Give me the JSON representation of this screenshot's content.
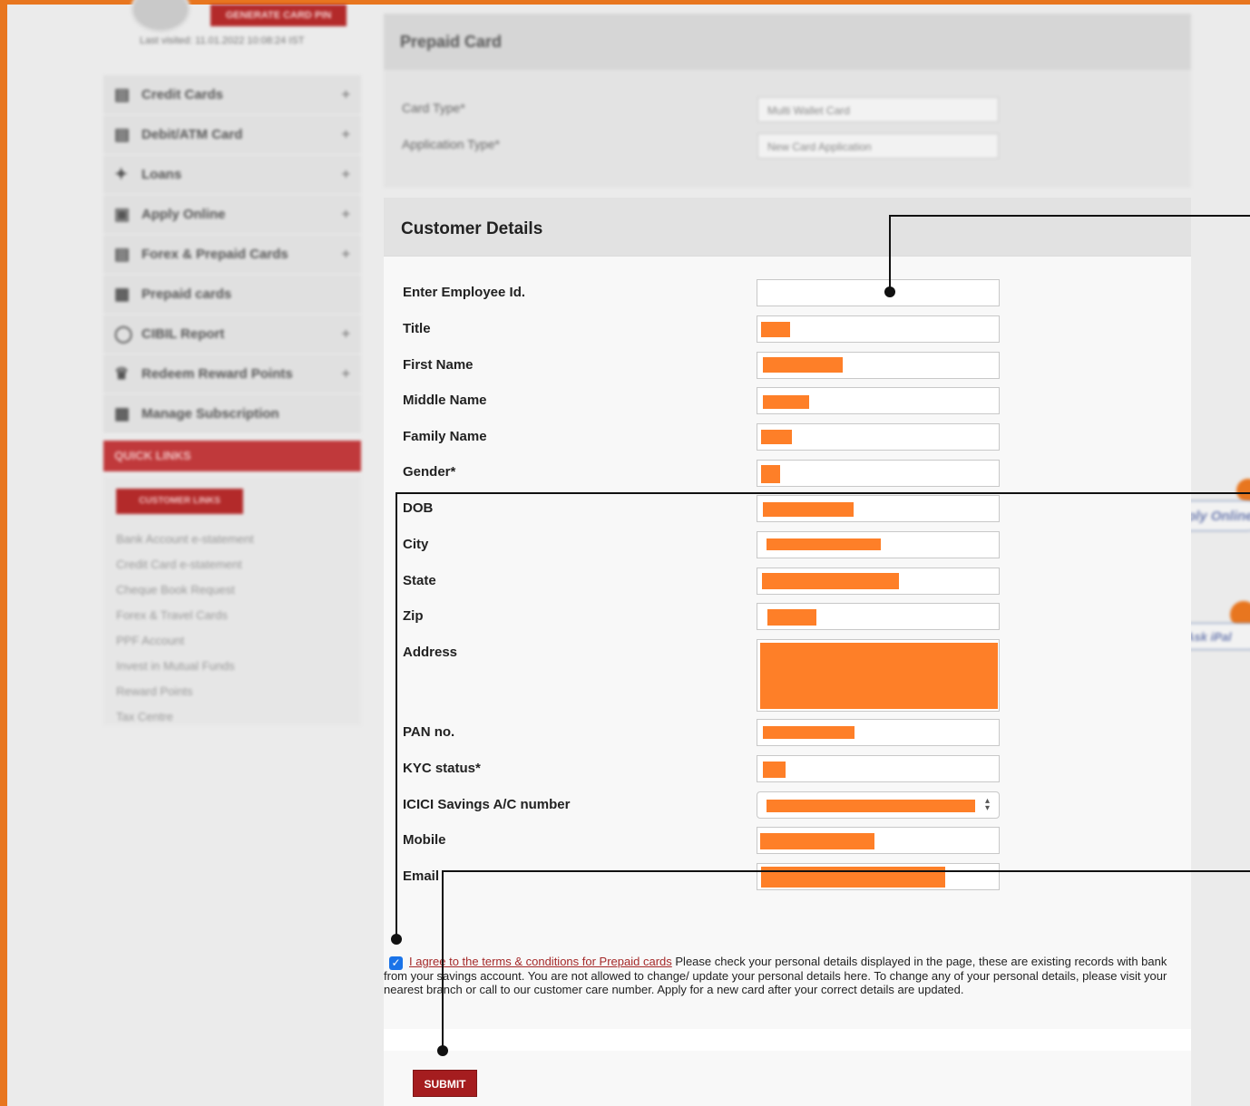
{
  "colors": {
    "frame": "#e8761f",
    "redaction": "#fe7f28",
    "submit": "#a51d1f",
    "link": "#a52a2a",
    "annotation": "#111111"
  },
  "sidebar": {
    "generate_button": "GENERATE CARD PIN",
    "last_visited": "Last visited: 11.01.2022 10:08:24 IST",
    "items": [
      {
        "label": "Credit Cards",
        "icon": "cards-icon"
      },
      {
        "label": "Debit/ATM Card",
        "icon": "cards-icon"
      },
      {
        "label": "Loans",
        "icon": "handshake-icon"
      },
      {
        "label": "Apply Online",
        "icon": "monitor-icon"
      },
      {
        "label": "Forex & Prepaid Cards",
        "icon": "cards-icon"
      },
      {
        "label": "Prepaid cards",
        "icon": "card-icon"
      },
      {
        "label": "CIBIL Report",
        "icon": "gauge-icon"
      },
      {
        "label": "Redeem Reward Points",
        "icon": "trophy-icon"
      },
      {
        "label": "Manage Subscription",
        "icon": "card-icon"
      }
    ],
    "quick_links_header": "QUICK LINKS",
    "customer_links_button": "CUSTOMER LINKS",
    "quick_links": [
      "Bank Account e-statement",
      "Credit Card e-statement",
      "Cheque Book Request",
      "Forex & Travel Cards",
      "PPF Account",
      "Invest in Mutual Funds",
      "Reward Points",
      "Tax Centre"
    ]
  },
  "prepaid": {
    "title": "Prepaid Card",
    "card_type_label": "Card Type*",
    "card_type_value": "Multi Wallet Card",
    "application_type_label": "Application Type*",
    "application_type_value": "New Card Application"
  },
  "right_badges": {
    "apply_online": "Apply Online",
    "ask_ipal": "Ask iPal"
  },
  "customer_details": {
    "title": "Customer Details",
    "fields": [
      {
        "label": "Enter Employee Id."
      },
      {
        "label": "Title"
      },
      {
        "label": "First Name"
      },
      {
        "label": "Middle Name"
      },
      {
        "label": "Family Name"
      },
      {
        "label": "Gender*"
      },
      {
        "label": "DOB"
      },
      {
        "label": "City"
      },
      {
        "label": "State"
      },
      {
        "label": "Zip"
      },
      {
        "label": "Address"
      },
      {
        "label": "PAN no."
      },
      {
        "label": "KYC status*"
      },
      {
        "label": "ICICI Savings A/C number"
      },
      {
        "label": "Mobile"
      },
      {
        "label": "Email"
      }
    ],
    "terms_link": "I agree to the terms & conditions for Prepaid cards",
    "notice": "Please check your personal details displayed in the page, these are existing records with bank from your savings account. You are not allowed to change/ update your personal details here. To change any of your personal details, please visit your nearest branch or call to our customer care number. Apply for a new card after your correct details are updated.",
    "submit_label": "SUBMIT"
  }
}
